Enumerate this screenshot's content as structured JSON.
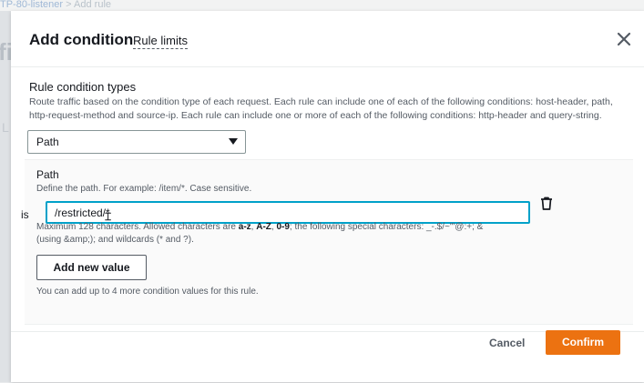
{
  "background": {
    "breadcrumb_link": "TP-80-listener",
    "breadcrumb_separator": ">",
    "breadcrumb_current": "Add rule",
    "side_fragment": "fi",
    "side_fragment2": "L"
  },
  "modal": {
    "title": "Add condition",
    "rule_limits_link": "Rule limits",
    "close_icon": "close-icon"
  },
  "condition_types": {
    "title": "Rule condition types",
    "description": "Route traffic based on the condition type of each request. Each rule can include one of each of the following conditions: host-header, path, http-request-method and source-ip. Each rule can include one or more of each of the following conditions: http-header and query-string.",
    "selected": "Path"
  },
  "path_condition": {
    "label": "Path",
    "description": "Define the path. For example: /item/*. Case sensitive.",
    "operator": "is",
    "value": "/restricted/*",
    "constraint_prefix": "Maximum 128 characters. Allowed characters are ",
    "constraint_chars1": "a-z",
    "constraint_sep1": ", ",
    "constraint_chars2": "A-Z",
    "constraint_sep2": ", ",
    "constraint_chars3": "0-9",
    "constraint_suffix": "; the following special characters: _-.$/~\"'@:+; & (using &amp;); and wildcards (* and ?).",
    "add_button": "Add new value",
    "hint": "You can add up to 4 more condition values for this rule."
  },
  "footer": {
    "cancel": "Cancel",
    "confirm": "Confirm"
  },
  "colors": {
    "accent": "#ec7211",
    "focus": "#00a1c9"
  }
}
